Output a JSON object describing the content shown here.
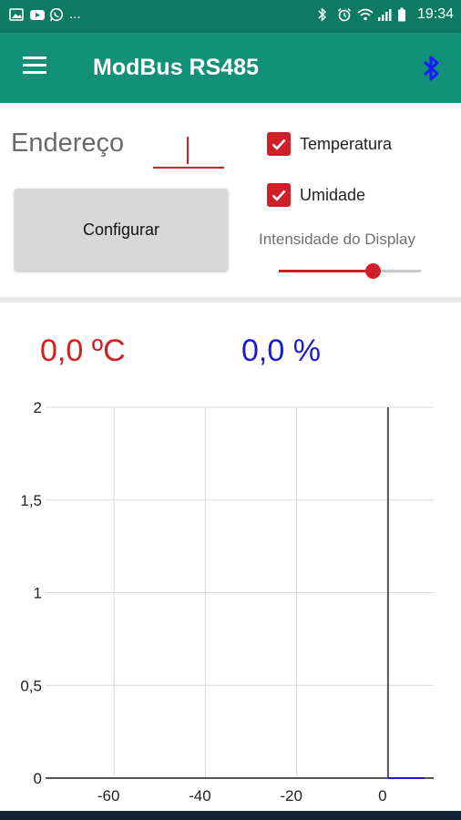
{
  "status_bar": {
    "left_text": "...",
    "time": "19:34",
    "icons": [
      "gallery-icon",
      "youtube-icon",
      "whatsapp-icon",
      "bluetooth-icon",
      "alarm-icon",
      "wifi-icon",
      "signal-icon",
      "battery-icon"
    ]
  },
  "app_bar": {
    "title": "ModBus RS485",
    "menu_icon": "hamburger-menu-icon",
    "bluetooth_icon": "bluetooth-icon",
    "bluetooth_color": "#1a1aff"
  },
  "config": {
    "address_label": "Endereço",
    "address_value": "",
    "configure_button": "Configurar",
    "temperature_checkbox": {
      "label": "Temperatura",
      "checked": true
    },
    "humidity_checkbox": {
      "label": "Umidade",
      "checked": true
    },
    "display_intensity_label": "Intensidade do Display",
    "display_intensity_fraction": 0.66
  },
  "readings": {
    "temperature": "0,0 ºC",
    "humidity": "0,0 %",
    "temperature_color": "#d11f1f",
    "humidity_color": "#1a1ad0"
  },
  "colors": {
    "appbar": "#139178",
    "statusbar": "#0d7a63",
    "accent": "#d11f2a"
  },
  "chart_data": {
    "type": "line",
    "title": "",
    "xlabel": "",
    "ylabel": "",
    "xlim": [
      -75,
      10
    ],
    "ylim": [
      0,
      2
    ],
    "x_ticks": [
      -60,
      -40,
      -20,
      0
    ],
    "x_tick_labels": [
      "-60",
      "-40",
      "-20",
      "0"
    ],
    "y_ticks": [
      0,
      0.5,
      1,
      1.5,
      2
    ],
    "y_tick_labels": [
      "0",
      "0,5",
      "1",
      "1,5",
      "2"
    ],
    "grid": true,
    "series": [
      {
        "color": "#d11f1f",
        "x": [
          0,
          8
        ],
        "y": [
          0,
          0
        ]
      },
      {
        "color": "#1a1ad0",
        "x": [
          0,
          8
        ],
        "y": [
          0,
          0
        ]
      }
    ]
  }
}
